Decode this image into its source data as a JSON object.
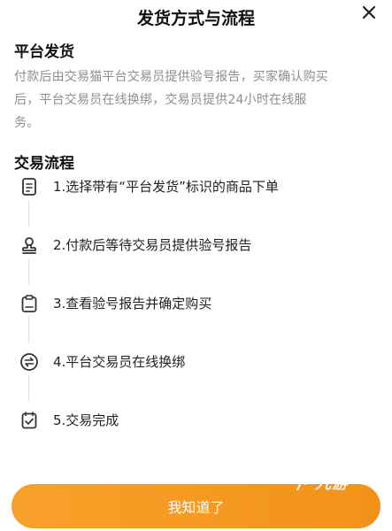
{
  "dialog": {
    "title": "发货方式与流程",
    "close_icon": "close-icon"
  },
  "platform_section": {
    "title": "平台发货",
    "description_lines": [
      "付款后由交易猫平台交易员提供验号报告，买家确认购买",
      "后，平台交易员在线换绑，交易员提供24小时在线服",
      "务。"
    ]
  },
  "process_section": {
    "title": "交易流程",
    "steps": [
      {
        "label": "1.选择带有“平台发货”标识的商品下单",
        "icon": "document-icon"
      },
      {
        "label": "2.付款后等待交易员提供验号报告",
        "icon": "seal-icon"
      },
      {
        "label": "3.查看验号报告并确定购买",
        "icon": "clipboard-icon"
      },
      {
        "label": "4.平台交易员在线换绑",
        "icon": "swap-icon"
      },
      {
        "label": "5.交易完成",
        "icon": "check-clipboard-icon"
      }
    ]
  },
  "footer": {
    "confirm_label": "我知道了",
    "accent_color": "#f59a1f"
  },
  "watermark": {
    "text": "九游"
  }
}
